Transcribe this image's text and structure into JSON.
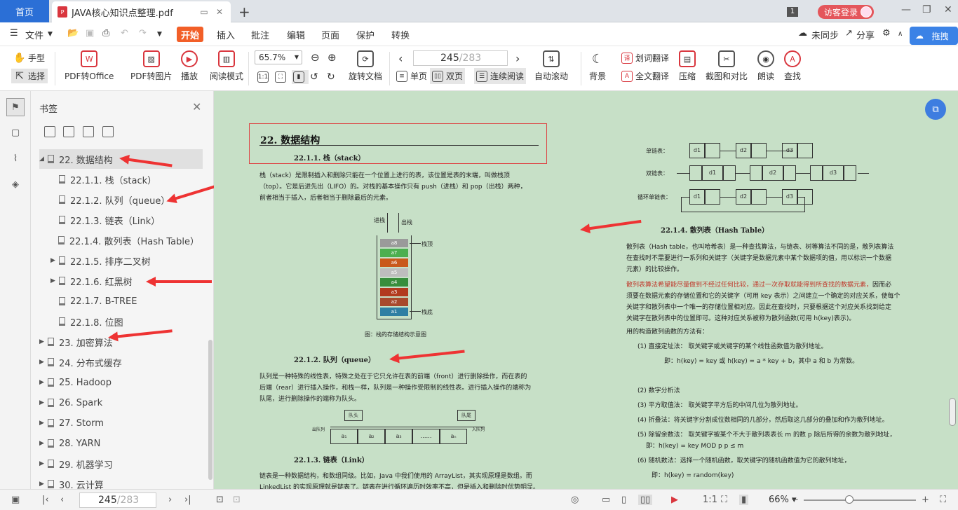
{
  "tabs": {
    "home": "首页",
    "doc": "JAVA核心知识点整理.pdf"
  },
  "top_right": {
    "page_badge": "1",
    "visitor": "访客登录"
  },
  "menu": {
    "file": "文件",
    "items": [
      "开始",
      "插入",
      "批注",
      "编辑",
      "页面",
      "保护",
      "转换"
    ],
    "sync": "未同步",
    "share": "分享",
    "drag": "拖拽"
  },
  "toolbar": {
    "hand": "手型",
    "select": "选择",
    "pdf_office": "PDF转Office",
    "pdf_image": "PDF转图片",
    "play": "播放",
    "read_mode": "阅读模式",
    "zoom": "65.7%",
    "rotate": "旋转文档",
    "page_current": "245",
    "page_total": "/283",
    "single": "单页",
    "double": "双页",
    "continuous": "连续阅读",
    "auto_scroll": "自动滚动",
    "background": "背景",
    "word_translate": "划词翻译",
    "full_translate": "全文翻译",
    "compress": "压缩",
    "screenshot": "截图和对比",
    "read_aloud": "朗读",
    "find": "查找"
  },
  "bookmarks": {
    "title": "书签",
    "items": [
      {
        "label": "22. 数据结构",
        "level": 0,
        "expanded": true,
        "selected": true
      },
      {
        "label": "22.1.1. 栈（stack）",
        "level": 1
      },
      {
        "label": "22.1.2. 队列（queue）",
        "level": 1
      },
      {
        "label": "22.1.3. 链表（Link）",
        "level": 1
      },
      {
        "label": "22.1.4. 散列表（Hash Table）",
        "level": 1
      },
      {
        "label": "22.1.5. 排序二叉树",
        "level": 1,
        "collapsed": true
      },
      {
        "label": "22.1.6. 红黑树",
        "level": 1,
        "collapsed": true
      },
      {
        "label": "22.1.7. B-TREE",
        "level": 1
      },
      {
        "label": "22.1.8. 位图",
        "level": 1
      },
      {
        "label": "23. 加密算法",
        "level": 0,
        "collapsed": true
      },
      {
        "label": "24. 分布式缓存",
        "level": 0,
        "collapsed": true
      },
      {
        "label": "25. Hadoop",
        "level": 0,
        "collapsed": true
      },
      {
        "label": "26. Spark",
        "level": 0,
        "collapsed": true
      },
      {
        "label": "27. Storm",
        "level": 0,
        "collapsed": true
      },
      {
        "label": "28. YARN",
        "level": 0,
        "collapsed": true
      },
      {
        "label": "29. 机器学习",
        "level": 0,
        "collapsed": true
      },
      {
        "label": "30. 云计算",
        "level": 0,
        "collapsed": true
      }
    ]
  },
  "left_page": {
    "chapter": "22.  数据结构",
    "s1": "22.1.1.     栈（stack）",
    "p1": [
      "栈（stack）是限制插入和删除只能在一个位置上进行的表，该位置是表的末端，叫做栈顶",
      "（top）。它是后进先出（LIFO）的。对栈的基本操作只有 push（进栈）和 pop（出栈）两种，",
      "前者相当于插入，后者相当于删除最后的元素。"
    ],
    "stack_labels": {
      "push": "进栈",
      "pop": "出栈",
      "top": "栈顶",
      "bottom": "栈底"
    },
    "stack_cells": [
      "a8",
      "a7",
      "a6",
      "a5",
      "a4",
      "a3",
      "a2",
      "a1"
    ],
    "stack_caption": "图：栈的存储结构示意图",
    "s2": "22.1.2.     队列（queue）",
    "p2": [
      "队列是一种特殊的线性表，特殊之处在于它只允许在表的前端（front）进行删除操作，而在表的",
      "后端（rear）进行插入操作，和栈一样，队列是一种操作受限制的线性表。进行插入操作的端称为",
      "队尾，进行删除操作的端称为队头。"
    ],
    "queue": {
      "head": "队头",
      "tail": "队尾",
      "out": "出队列",
      "in": "入队列",
      "cells": [
        "a₁",
        "a₂",
        "a₃",
        "……",
        "aₙ"
      ]
    },
    "s3": "22.1.3.     链表（Link）",
    "p3": [
      "链表是一种数据结构，和数组同级。比如，Java 中我们使用的 ArrayList，其实现原理是数组。而",
      "LinkedList 的实现原理就是链表了。链表在进行循环遍历时效率不高，但是插入和删除时优势明显。"
    ]
  },
  "right_page": {
    "list_labels": {
      "single": "单链表：",
      "double": "双链表：",
      "circular": "循环单链表："
    },
    "single_nodes": [
      "d1",
      "d2",
      "d3"
    ],
    "double_nodes": [
      "d1",
      "d2",
      "d3"
    ],
    "circular_nodes": [
      "d1",
      "d2",
      "d3"
    ],
    "s4": "22.1.4.     散列表（Hash Table）",
    "p4": [
      "散列表（Hash table，也叫哈希表）是一种查找算法，与链表、树等算法不同的是，散列表算法",
      "在查找时不需要进行一系列和关键字（关键字是数据元素中某个数据项的值，用以标识一个数据",
      "元素）的比较操作。"
    ],
    "p5_red": "散列表算法希望能尽量做到不经过任何比较，通过一次存取就能得到所查找的数据元素，",
    "p5_rest": [
      "因而必",
      "须要在数据元素的存储位置和它的关键字（可用 key 表示）之间建立一个确定的对应关系，使每个",
      "关键字和散列表中一个唯一的存储位置相对应。因此在查找时，只要根据这个对应关系找到给定",
      "关键字在散列表中的位置即可。这种对应关系被称为散列函数(可用 h(key)表示)。"
    ],
    "p6": "用的构造散列函数的方法有：",
    "m1": "(1)  直接定址法：  取关键字或关键字的某个线性函数值为散列地址。",
    "m1b": "即：h(key) = key   或 h(key) = a * key + b，其中 a 和 b 为常数。",
    "m2": "(2)  数字分析法",
    "m3": "(3)  平方取值法：  取关键字平方后的中间几位为散列地址。",
    "m4": "(4)  折叠法：将关键字分割成位数相同的几部分，然后取这几部分的叠加和作为散列地址。",
    "m5": "(5)  除留余数法：  取关键字被某个不大于散列表表长 m 的数 p 除后所得的余数为散列地址，",
    "m5b": "即：h(key) = key MOD p    p ≤ m",
    "m6": "(6)  随机数法：选择一个随机函数，取关键字的随机函数值为它的散列地址，",
    "m6b": "即：h(key) = random(key)"
  },
  "status": {
    "page_current": "245",
    "page_total": "/283",
    "zoom": "66%"
  },
  "colors": {
    "accent": "#2b6fd6",
    "start": "#f25f28",
    "viewer_bg": "#c7e0c7",
    "red_arrow": "#e33333"
  }
}
